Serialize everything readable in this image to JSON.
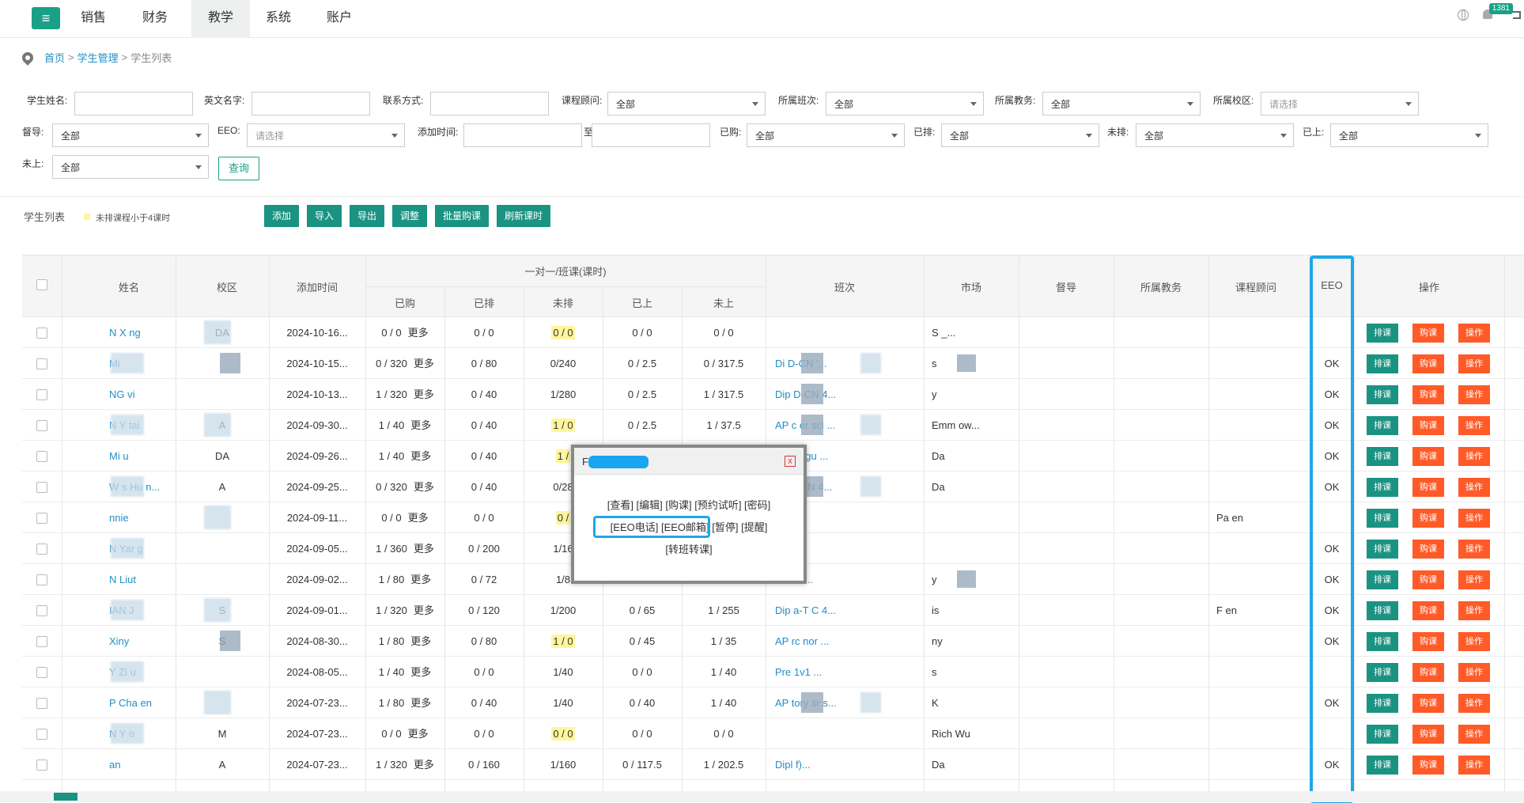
{
  "topnav": {
    "items": [
      "销售",
      "财务",
      "教学",
      "系统",
      "账户"
    ],
    "active": "教学",
    "badge": "1381"
  },
  "breadcrumb": {
    "home": "首页",
    "sep": ">",
    "level1": "学生管理",
    "current": "学生列表"
  },
  "filters": {
    "student_name": "学生姓名:",
    "english_name": "英文名字:",
    "contact": "联系方式:",
    "consultant": "课程顾问:",
    "class": "所属班次:",
    "edu": "所属教务:",
    "campus": "所属校区:",
    "supervisor": "督导:",
    "eeo": "EEO:",
    "add_time": "添加时间:",
    "to": "至",
    "bought": "已购:",
    "scheduled": "已排:",
    "unscheduled": "未排:",
    "attended": "已上:",
    "unattended": "未上:",
    "all": "全部",
    "choose": "请选择",
    "query": "查询"
  },
  "toolbar": {
    "title": "学生列表",
    "legend": "未排课程小于4课时",
    "buttons": [
      "添加",
      "导入",
      "导出",
      "调整",
      "批量购课",
      "刷新课时"
    ]
  },
  "table": {
    "headers": {
      "name": "姓名",
      "campus": "校区",
      "add_time": "添加时间",
      "group": "一对一/班课(课时)",
      "bought": "已购",
      "scheduled": "已排",
      "unscheduled": "未排",
      "attended": "已上",
      "unattended": "未上",
      "class": "班次",
      "market": "市场",
      "supervisor": "督导",
      "edu": "所属教务",
      "consultant": "课程顾问",
      "eeo": "EEO",
      "ops": "操作"
    },
    "more": "更多",
    "actions": [
      "排课",
      "购课",
      "操作"
    ],
    "rows": [
      {
        "name": "N X   ng",
        "campus": "DA",
        "time": "2024-10-16...",
        "bought": "0 / 0",
        "sched": "0 / 0",
        "unsched": "0 / 0",
        "hl": true,
        "att": "0 / 0",
        "unatt": "0 / 0",
        "class": "",
        "market": "S       _...",
        "cons": "",
        "eeo": ""
      },
      {
        "name": "Mi",
        "campus": "",
        "time": "2024-10-15...",
        "bought": "0 / 320",
        "sched": "0 / 80",
        "unsched": "0/240",
        "hl": false,
        "att": "0 / 2.5",
        "unatt": "0 / 317.5",
        "class": "Di        D-CN    '...",
        "market": "s",
        "cons": "",
        "eeo": "OK"
      },
      {
        "name": "NG   vi",
        "campus": "",
        "time": "2024-10-13...",
        "bought": "1 / 320",
        "sched": "0 / 40",
        "unsched": "1/280",
        "hl": false,
        "att": "0 / 2.5",
        "unatt": "1 / 317.5",
        "class": "Dip          D-CN    4...",
        "market": "y",
        "cons": "",
        "eeo": "OK"
      },
      {
        "name": "N Y   tai",
        "campus": "A",
        "time": "2024-09-30...",
        "bought": "1 / 40",
        "sched": "0 / 40",
        "unsched": "1 / 0",
        "hl": true,
        "att": "0 / 2.5",
        "unatt": "1 / 37.5",
        "class": "AP c       er sci        ...",
        "market": "Emm      ow...",
        "cons": "",
        "eeo": "OK"
      },
      {
        "name": "Mi    u",
        "campus": "DA",
        "time": "2024-09-26...",
        "bought": "1 / 40",
        "sched": "0 / 40",
        "unsched": "1 /",
        "hl": true,
        "att": "",
        "unatt": "",
        "class": "gli  Langu       ...",
        "market": "Da",
        "cons": "",
        "eeo": "OK"
      },
      {
        "name": "W   s Hu   n...",
        "campus": "A",
        "time": "2024-09-25...",
        "bought": "0 / 320",
        "sched": "0 / 40",
        "unsched": "0/28",
        "hl": false,
        "att": "",
        "unatt": "",
        "class": "na    D-CN      4...",
        "market": "Da",
        "cons": "",
        "eeo": "OK"
      },
      {
        "name": "nnie",
        "campus": "",
        "time": "2024-09-11...",
        "bought": "0 / 0",
        "sched": "0 / 0",
        "unsched": "0 /",
        "hl": true,
        "att": "",
        "unatt": "",
        "class": "",
        "market": "",
        "cons": "Pa          en",
        "eeo": ""
      },
      {
        "name": "N Yar   g",
        "campus": "",
        "time": "2024-09-05...",
        "bought": "1 / 360",
        "sched": "0 / 200",
        "unsched": "1/16",
        "hl": false,
        "att": "",
        "unatt": "",
        "class": "a  i   all      .",
        "market": "",
        "cons": "",
        "eeo": "OK"
      },
      {
        "name": "N Liut",
        "campus": "",
        "time": "2024-09-02...",
        "bought": "1 / 80",
        "sched": "0 / 72",
        "unsched": "1/8",
        "hl": false,
        "att": "",
        "unatt": "",
        "class": "h l s    c         ...",
        "market": "y",
        "cons": "",
        "eeo": "OK"
      },
      {
        "name": "IAN J",
        "campus": "S",
        "time": "2024-09-01...",
        "bought": "1 / 320",
        "sched": "0 / 120",
        "unsched": "1/200",
        "hl": false,
        "att": "0 / 65",
        "unatt": "1 / 255",
        "class": "Dip    a-T     C       4...",
        "market": "is",
        "cons": "F           en",
        "eeo": "OK"
      },
      {
        "name": "Xiny",
        "campus": "S",
        "time": "2024-08-30...",
        "bought": "1 / 80",
        "sched": "0 / 80",
        "unsched": "1 / 0",
        "hl": true,
        "att": "0 / 45",
        "unatt": "1 / 35",
        "class": "AP     rc   nor       ...",
        "market": "ny",
        "cons": "",
        "eeo": "OK"
      },
      {
        "name": "Y    Zi    u",
        "campus": "",
        "time": "2024-08-05...",
        "bought": "1 / 40",
        "sched": "0 / 0",
        "unsched": "1/40",
        "hl": false,
        "att": "0 / 0",
        "unatt": "1 / 40",
        "class": "Pre        1v1        ...",
        "market": "s",
        "cons": "",
        "eeo": ""
      },
      {
        "name": "P    Cha    en",
        "campus": "",
        "time": "2024-07-23...",
        "bought": "1 / 80",
        "sched": "0 / 40",
        "unsched": "1/40",
        "hl": false,
        "att": "0 / 40",
        "unatt": "1 / 40",
        "class": "AP        tory sr        s...",
        "market": "K",
        "cons": "",
        "eeo": "OK"
      },
      {
        "name": "N Y    o",
        "campus": "M",
        "time": "2024-07-23...",
        "bought": "0 / 0",
        "sched": "0 / 0",
        "unsched": "0 / 0",
        "hl": true,
        "att": "0 / 0",
        "unatt": "0 / 0",
        "class": "",
        "market": "Rich       Wu",
        "cons": "",
        "eeo": ""
      },
      {
        "name": "an",
        "campus": "A",
        "time": "2024-07-23...",
        "bought": "1 / 320",
        "sched": "0 / 160",
        "unsched": "1/160",
        "hl": false,
        "att": "0 / 117.5",
        "unatt": "1 / 202.5",
        "class": "Dipl                  f)...",
        "market": "Da",
        "cons": "",
        "eeo": "OK"
      }
    ]
  },
  "modal": {
    "title": "F",
    "line1": "[查看] [编辑] [购课] [预约试听] [密码]",
    "line2a": "[EEO电话] [EEO邮箱]",
    "line2b": " [暂停] [提醒]",
    "line3": "[转班转课]",
    "close": "x"
  },
  "colors": {
    "brand": "#1aa086",
    "action_green": "#1a9382",
    "action_orange": "#ff5a27",
    "highlight": "#fff59d",
    "eeo_outline": "#1ea7e8"
  }
}
